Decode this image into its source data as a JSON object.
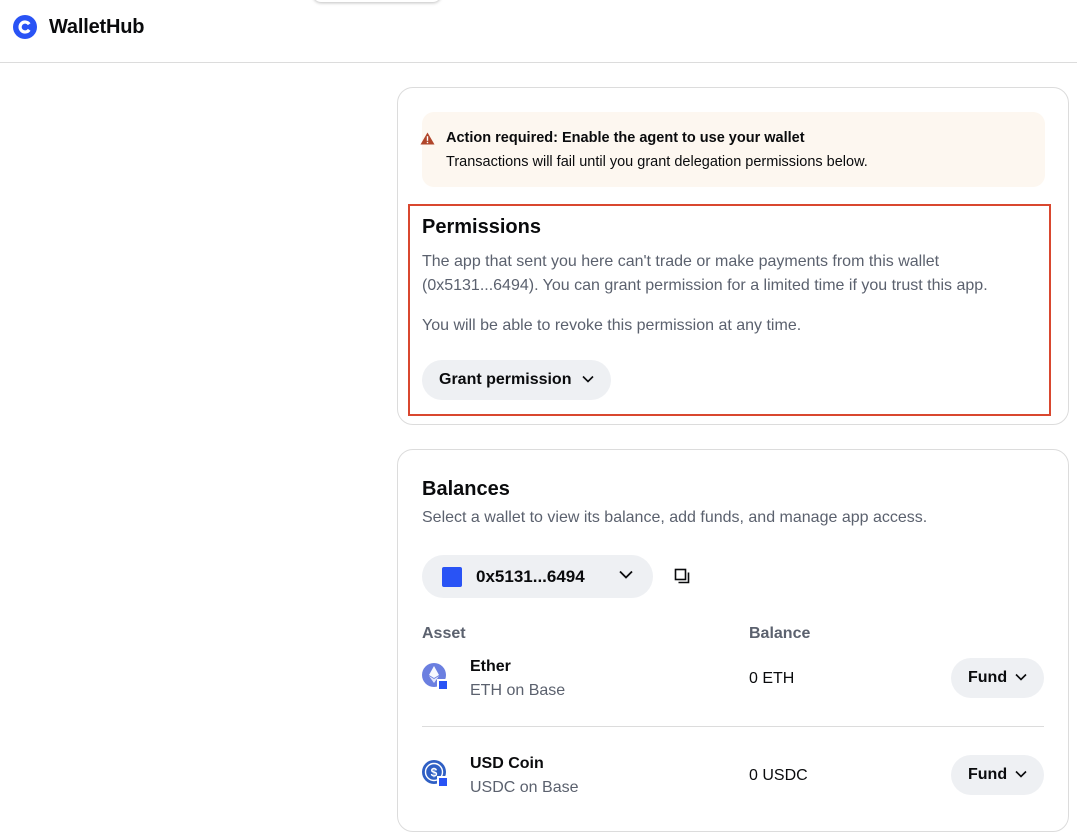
{
  "app": {
    "brand": "WalletHub"
  },
  "alert": {
    "title": "Action required: Enable the agent to use your wallet",
    "body": "Transactions will fail until you grant delegation permissions below."
  },
  "permissions": {
    "title": "Permissions",
    "description": "The app that sent you here can't trade or make payments from this wallet (0x5131...6494). You can grant permission for a limited time if you trust this app.",
    "revoke_note": "You will be able to revoke this permission at any time.",
    "grant_label": "Grant permission"
  },
  "balances": {
    "title": "Balances",
    "subtitle": "Select a wallet to view its balance, add funds, and manage app access.",
    "selected_wallet": "0x5131...6494",
    "columns": {
      "asset": "Asset",
      "balance": "Balance"
    },
    "assets": [
      {
        "name": "Ether",
        "network": "ETH on Base",
        "balance": "0 ETH",
        "action": "Fund",
        "icon": "ether-icon"
      },
      {
        "name": "USD Coin",
        "network": "USDC on Base",
        "balance": "0 USDC",
        "action": "Fund",
        "icon": "usdc-icon"
      }
    ]
  },
  "colors": {
    "brand_blue": "#2953f5",
    "alert_background": "#fdf7f0",
    "warning": "#b0452a",
    "highlight_border": "#d9472f",
    "button_background": "#eef0f3"
  }
}
